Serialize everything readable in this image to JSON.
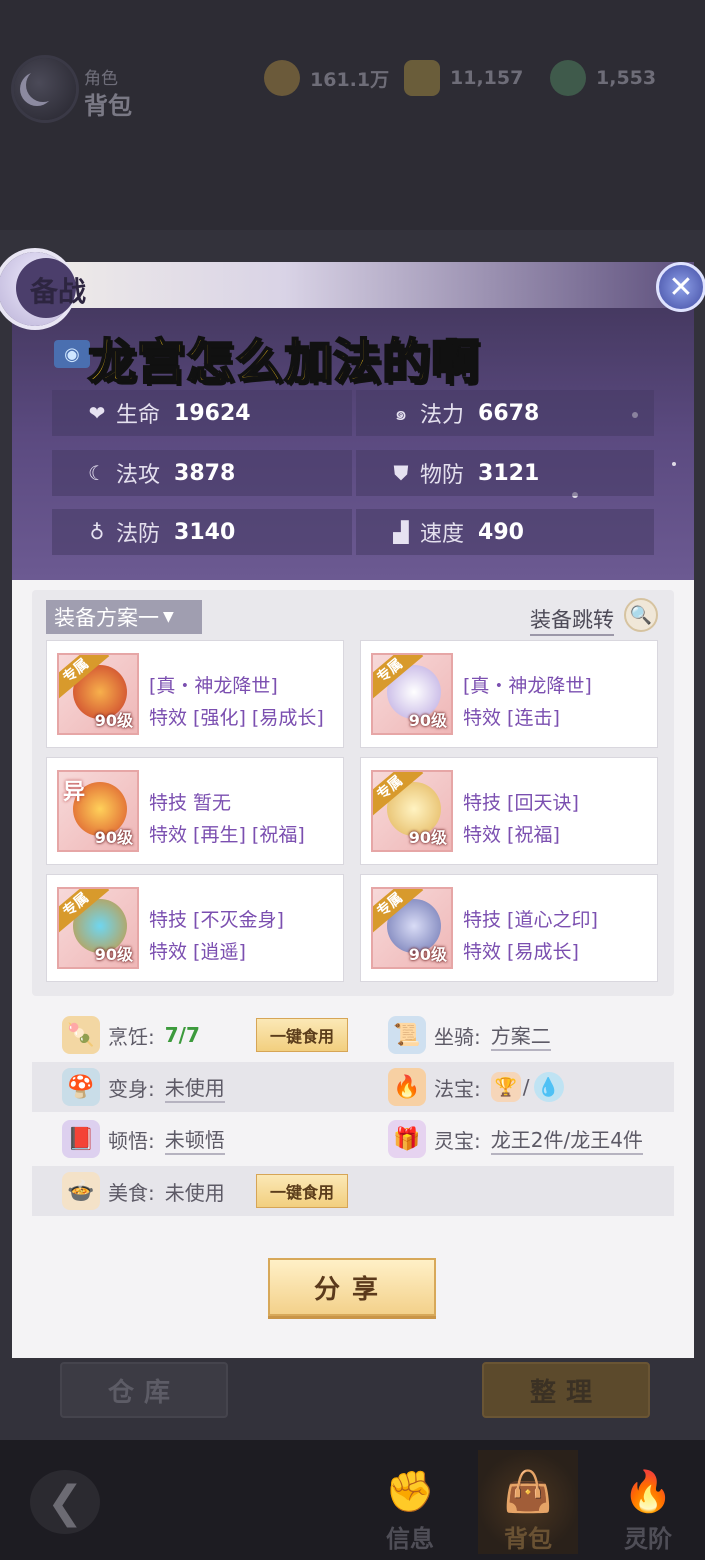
{
  "background": {
    "header_subtitle": "角色",
    "header_title": "背包",
    "currencies": [
      {
        "icon": "coin-icon",
        "value": "161.1万"
      },
      {
        "icon": "silver-ingot-icon",
        "value": "11,157"
      },
      {
        "icon": "jade-icon",
        "value": "1,553"
      }
    ],
    "buttons": {
      "warehouse": "仓库",
      "organize": "整理"
    },
    "nav": {
      "back": "❮",
      "items": [
        {
          "label": "信息",
          "icon": "fist-icon"
        },
        {
          "label": "背包",
          "icon": "bag-icon"
        },
        {
          "label": "灵阶",
          "icon": "flame-icon"
        }
      ]
    }
  },
  "dialog": {
    "title": "备战",
    "close": "✕",
    "overlay_caption": "龙宫怎么加法的啊",
    "stats": [
      {
        "icon": "heart-icon",
        "glyph": "❤",
        "label": "生命",
        "value": "19624"
      },
      {
        "icon": "spiral-icon",
        "glyph": "๑",
        "label": "法力",
        "value": "6678"
      },
      {
        "icon": "magic-attack-icon",
        "glyph": "☾",
        "label": "法攻",
        "value": "3878"
      },
      {
        "icon": "shield-icon",
        "glyph": "⛊",
        "label": "物防",
        "value": "3121"
      },
      {
        "icon": "magic-defense-icon",
        "glyph": "♁",
        "label": "法防",
        "value": "3140"
      },
      {
        "icon": "boot-icon",
        "glyph": "▟",
        "label": "速度",
        "value": "490"
      }
    ],
    "equipment": {
      "scheme": "装备方案一",
      "jump_label": "装备跳转",
      "items": [
        {
          "tag": "专属",
          "level": "90级",
          "line1": "[真・神龙降世]",
          "line2": "特效 [强化] [易成长]",
          "art": "#e05a3a"
        },
        {
          "tag": "专属",
          "level": "90级",
          "line1": "[真・神龙降世]",
          "line2": "特效 [连击]",
          "art": "#c9b8e8"
        },
        {
          "tag": "异",
          "level": "90级",
          "line1": "特技 暂无",
          "line2": "特效 [再生] [祝福]",
          "art": "#e58a2c"
        },
        {
          "tag": "专属",
          "level": "90级",
          "line1": "特技 [回天诀]",
          "line2": "特效 [祝福]",
          "art": "#e8c66a"
        },
        {
          "tag": "专属",
          "level": "90级",
          "line1": "特技 [不灭金身]",
          "line2": "特效 [逍遥]",
          "art": "#3aa8c8"
        },
        {
          "tag": "专属",
          "level": "90级",
          "line1": "特技 [道心之印]",
          "line2": "特效 [易成长]",
          "art": "#7f8ac0"
        }
      ]
    },
    "info": {
      "cooking": {
        "label": "烹饪:",
        "value": "7/7",
        "button": "一键食用"
      },
      "mount": {
        "label": "坐骑:",
        "value": "方案二"
      },
      "transform": {
        "label": "变身:",
        "value": "未使用"
      },
      "treasure": {
        "label": "法宝:",
        "sep": "/"
      },
      "insight": {
        "label": "顿悟:",
        "value": "未顿悟"
      },
      "spirit": {
        "label": "灵宝:",
        "value": "龙王2件/龙王4件"
      },
      "food": {
        "label": "美食:",
        "value": "未使用",
        "button": "一键食用"
      }
    },
    "share": "分享"
  }
}
